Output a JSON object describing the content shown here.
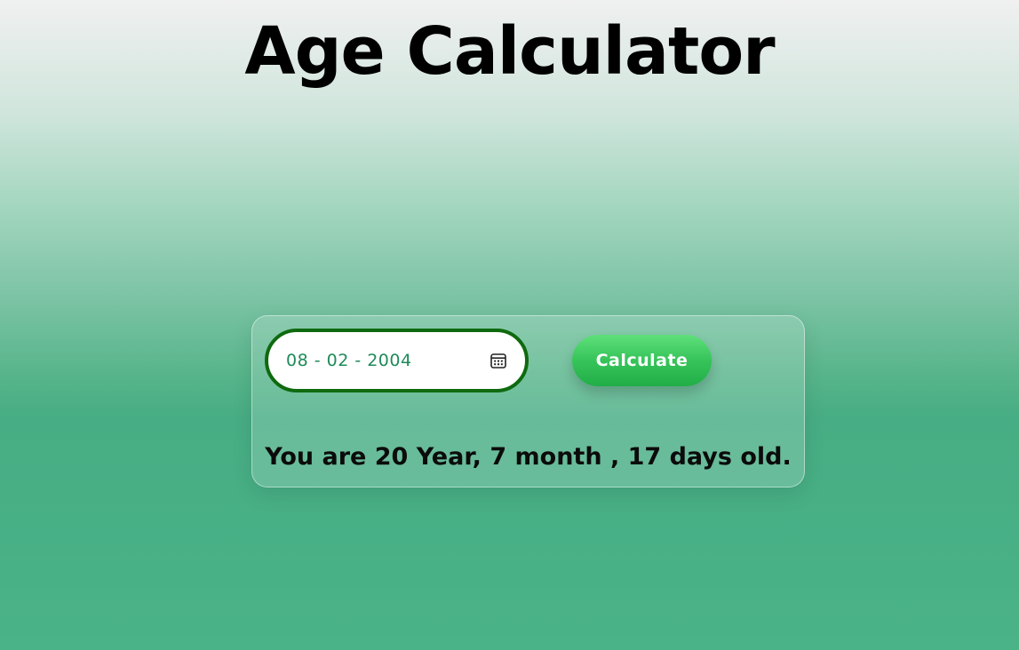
{
  "header": {
    "title": "Age Calculator"
  },
  "form": {
    "date_value": "08 - 02 - 2004",
    "date_icon": "calendar-icon",
    "calculate_label": "Calculate"
  },
  "result": {
    "text": "You are 20 Year, 7 month , 17 days old."
  },
  "colors": {
    "input_border": "#0f6a0f",
    "input_text": "#1f8a5a",
    "button_top": "#5fe07a",
    "button_bottom": "#21ae47",
    "background_top": "#f0f0f0",
    "background_bottom": "#4ab387"
  }
}
